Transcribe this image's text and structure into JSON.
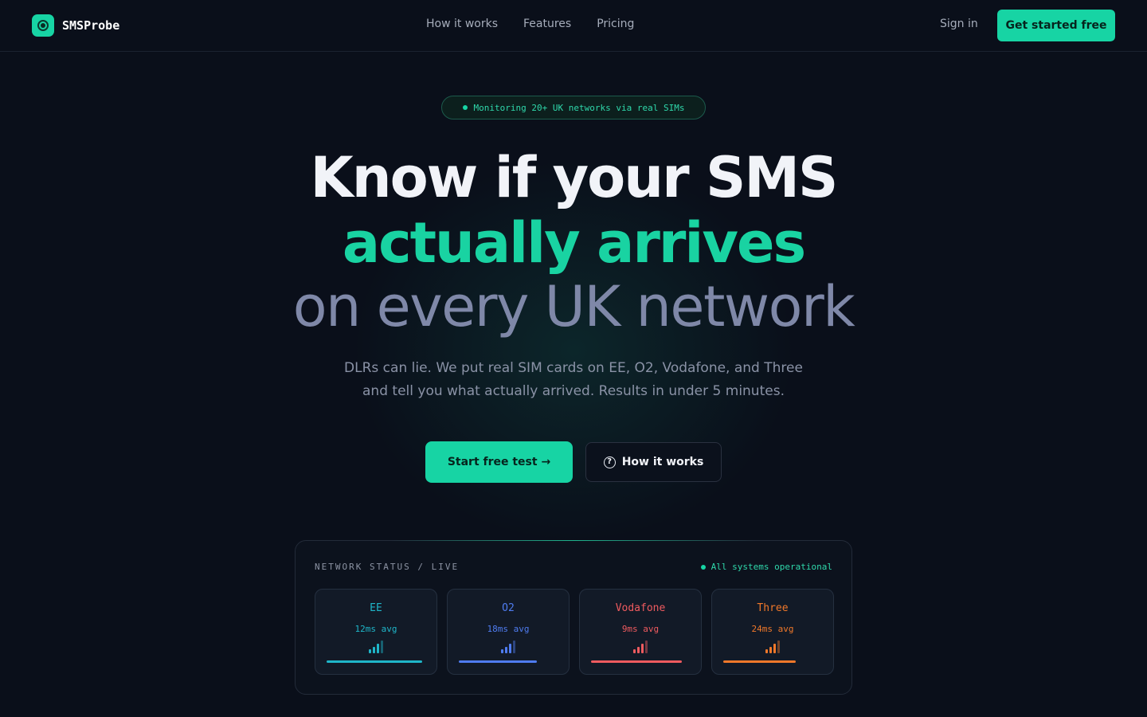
{
  "brand": {
    "name": "SMSProbe"
  },
  "nav": {
    "links": [
      "How it works",
      "Features",
      "Pricing"
    ],
    "signin": "Sign in",
    "cta": "Get started free"
  },
  "hero": {
    "badge": "Monitoring 20+ UK networks via real SIMs",
    "line1": "Know if your SMS",
    "line2": "actually arrives",
    "line3": "on every UK network",
    "sub1": "DLRs can lie. We put real SIM cards on EE, O2, Vodafone, and Three",
    "sub2": "and tell you what actually arrived. Results in under 5 minutes.",
    "primary_btn": "Start free test →",
    "secondary_btn": "How it works"
  },
  "status_panel": {
    "title": "NETWORK STATUS / LIVE",
    "status": "All systems operational",
    "networks": [
      {
        "name": "EE",
        "latency": "12ms avg",
        "color": "#1fb6c9",
        "level": 1.0
      },
      {
        "name": "O2",
        "latency": "18ms avg",
        "color": "#4f7cf0",
        "level": 0.82
      },
      {
        "name": "Vodafone",
        "latency": "9ms avg",
        "color": "#ef5b5f",
        "level": 0.95
      },
      {
        "name": "Three",
        "latency": "24ms avg",
        "color": "#f0782a",
        "level": 0.76
      }
    ]
  },
  "colors": {
    "accent": "#17d4a4",
    "background": "#0a0f1a"
  }
}
